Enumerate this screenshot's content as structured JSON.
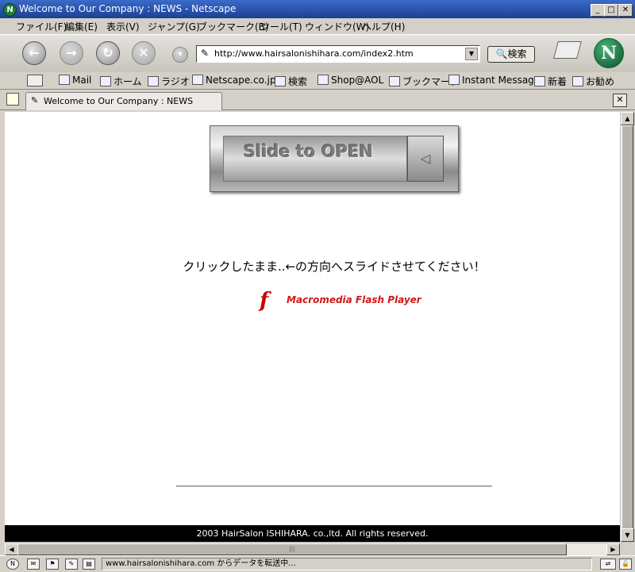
{
  "window": {
    "title": "Welcome to Our Company : NEWS - Netscape"
  },
  "menu": [
    "ファイル(F)",
    "編集(E)",
    "表示(V)",
    "ジャンプ(G)",
    "ブックマーク(B)",
    "ツール(T)",
    "ウィンドウ(W)",
    "ヘルプ(H)"
  ],
  "nav": {
    "url": "http://www.hairsalonishihara.com/index2.htm",
    "search_label": "検索",
    "logo_letter": "N"
  },
  "personal_toolbar": [
    "Mail",
    "ホーム",
    "ラジオ",
    "Netscape.co.jp",
    "検索",
    "Shop@AOL",
    "ブックマーク",
    "Instant Message",
    "新着",
    "お勧め"
  ],
  "tab": {
    "label": "Welcome to Our Company : NEWS"
  },
  "page": {
    "slider_text": "Slide to OPEN",
    "slider_arrow": "◁",
    "instruction": "クリックしたまま..←の方向へスライドさせてください！",
    "flash_logo": "f",
    "flash_label": "Macromedia Flash Player",
    "footer": "2003 HairSalon ISHIHARA. co.,ltd. All rights reserved."
  },
  "status": {
    "text": "www.hairsalonishihara.com からデータを転送中..."
  },
  "colors": {
    "titlebar": "#2a55b0",
    "flash_red": "#d01818",
    "footer_bg": "#000000"
  }
}
